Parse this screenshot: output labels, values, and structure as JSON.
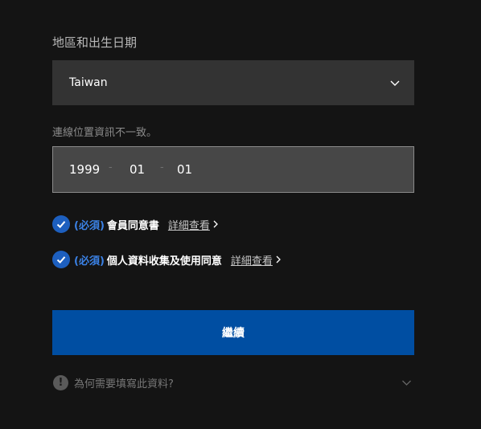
{
  "section": {
    "title": "地區和出生日期"
  },
  "region": {
    "selected": "Taiwan"
  },
  "location_notice": "連線位置資訊不一致。",
  "birthdate": {
    "year": "1999",
    "month": "01",
    "day": "01",
    "separator": "-"
  },
  "agreements": [
    {
      "required_tag": "(必須)",
      "label": "會員同意書",
      "link": "詳細查看",
      "checked": true
    },
    {
      "required_tag": "(必須)",
      "label": "個人資料收集及使用同意",
      "link": "詳細查看",
      "checked": true
    }
  ],
  "continue_button": "繼續",
  "why_info": {
    "icon": "!",
    "text": "為何需要填寫此資料?"
  },
  "colors": {
    "background": "#141414",
    "accent": "#004ea2",
    "check": "#1d5fbf",
    "required": "#3b82e6"
  }
}
